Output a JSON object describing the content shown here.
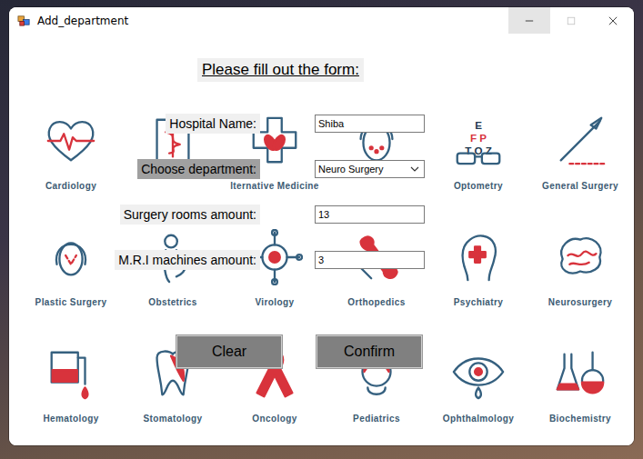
{
  "window": {
    "title": "Add_department",
    "controls": [
      {
        "kind": "minimize",
        "disabled": false,
        "highlighted": true
      },
      {
        "kind": "maximize",
        "disabled": true,
        "highlighted": false
      },
      {
        "kind": "close",
        "disabled": false,
        "highlighted": false
      }
    ]
  },
  "form": {
    "heading": "Please fill out the form:",
    "fields": [
      {
        "kind": "text",
        "label": "Hospital Name:",
        "value": "Shiba",
        "label_highlighted": false
      },
      {
        "kind": "dropdown",
        "label": "Choose department:",
        "value": "Neuro Surgery",
        "label_highlighted": true
      },
      {
        "kind": "text",
        "label": "Surgery rooms amount:",
        "value": "13",
        "label_highlighted": false
      },
      {
        "kind": "text",
        "label": "M.R.I machines amount:",
        "value": "3",
        "label_highlighted": false
      }
    ],
    "buttons": [
      "Clear",
      "Confirm"
    ]
  },
  "background_tiles": [
    {
      "caption": "Cardiology",
      "chart": []
    },
    {
      "caption": "",
      "chart": []
    },
    {
      "caption": "lternative Medicine",
      "chart": []
    },
    {
      "caption": "",
      "chart": []
    },
    {
      "caption": "Optometry",
      "chart": [
        "E",
        "F P",
        "T O Z"
      ]
    },
    {
      "caption": "General Surgery",
      "chart": []
    },
    {
      "caption": "Plastic Surgery",
      "chart": []
    },
    {
      "caption": "Obstetrics",
      "chart": []
    },
    {
      "caption": "Virology",
      "chart": []
    },
    {
      "caption": "Orthopedics",
      "chart": []
    },
    {
      "caption": "Psychiatry",
      "chart": []
    },
    {
      "caption": "Neurosurgery",
      "chart": []
    },
    {
      "caption": "Hematology",
      "chart": []
    },
    {
      "caption": "Stomatology",
      "chart": []
    },
    {
      "caption": "Oncology",
      "chart": []
    },
    {
      "caption": "Pediatrics",
      "chart": []
    },
    {
      "caption": "Ophthalmology",
      "chart": []
    },
    {
      "caption": "Biochemistry",
      "chart": []
    }
  ]
}
